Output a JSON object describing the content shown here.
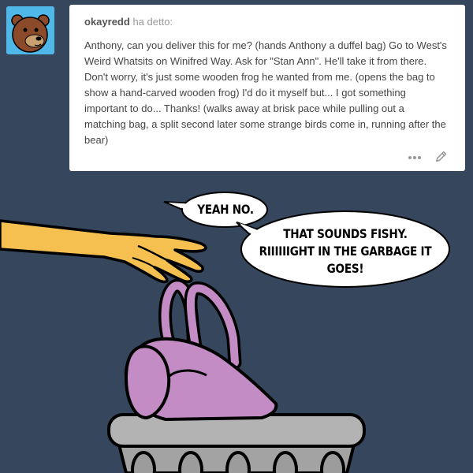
{
  "post": {
    "username": "okayredd",
    "said_label": "ha detto:",
    "message": "Anthony, can you deliver this for me? (hands Anthony a duffel bag) Go to West's Weird Whatsits on Winifred Way. Ask for \"Stan Ann\". He'll take it from there. Don't worry, it's just some wooden frog he wanted from me. (opens the bag to show a hand-carved wooden frog) I'd do it myself but... I got something important to do... Thanks! (walks away at brisk pace while pulling out a matching bag, a split second later some strange birds come in, running after the bear)",
    "avatar_icon": "bear-avatar-icon",
    "more_icon": "more-dots-icon",
    "edit_icon": "pencil-icon"
  },
  "comic": {
    "bubble1": "YEAH NO.",
    "bubble2_line1": "THAT SOUNDS FISHY.",
    "bubble2_line2": "RIIIIIIGHT IN THE GARBAGE IT",
    "bubble2_line3": "GOES!"
  },
  "colors": {
    "background": "#36465d",
    "hand": "#f5c050",
    "bag": "#c48cc4",
    "trash_can": "#b3b3b3"
  }
}
